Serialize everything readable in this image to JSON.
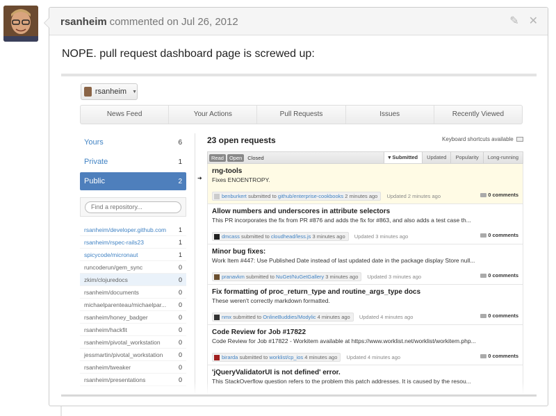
{
  "comment": {
    "author": "rsanheim",
    "action": "commented on Jul 26, 2012",
    "text": "NOPE. pull request dashboard page is screwed up:"
  },
  "screenshot": {
    "context_user": "rsanheim",
    "tabs": [
      "News Feed",
      "Your Actions",
      "Pull Requests",
      "Issues",
      "Recently Viewed"
    ],
    "filters": [
      {
        "label": "Yours",
        "count": "6"
      },
      {
        "label": "Private",
        "count": "1"
      },
      {
        "label": "Public",
        "count": "2"
      }
    ],
    "repo_search_placeholder": "Find a repository...",
    "repos": [
      {
        "name": "rsanheim/developer.github.com",
        "count": "1"
      },
      {
        "name": "rsanheim/rspec-rails23",
        "count": "1"
      },
      {
        "name": "spicycode/micronaut",
        "count": "1"
      },
      {
        "name": "runcoderun/gem_sync",
        "count": "0"
      },
      {
        "name": "zkim/clojuredocs",
        "count": "0"
      },
      {
        "name": "rsanheim/documents",
        "count": "0"
      },
      {
        "name": "michaelparenteau/michaelpar...",
        "count": "0"
      },
      {
        "name": "rsanheim/honey_badger",
        "count": "0"
      },
      {
        "name": "rsanheim/hackfit",
        "count": "0"
      },
      {
        "name": "rsanheim/pivotal_workstation",
        "count": "0"
      },
      {
        "name": "jessmartin/pivotal_workstation",
        "count": "0"
      },
      {
        "name": "rsanheim/tweaker",
        "count": "0"
      },
      {
        "name": "rsanheim/presentations",
        "count": "0"
      }
    ],
    "main_title": "23 open requests",
    "keyboard_note": "Keyboard shortcuts available",
    "state_buttons": [
      "Read",
      "Open",
      "Closed"
    ],
    "sorts": [
      "Submitted",
      "Updated",
      "Popularity",
      "Long-running"
    ],
    "pull_requests": [
      {
        "title": "rng-tools",
        "desc": "Fixes ENOENTROPY.",
        "user": "benburkert",
        "submitted": "submitted to",
        "repo": "github/enterprise-cookbooks",
        "ago": "2 minutes ago",
        "updated": "Updated 2 minutes ago",
        "comments": "0 comments"
      },
      {
        "title": "Allow numbers and underscores in attribute selectors",
        "desc": "This PR incorporates the fix from PR #876 and adds the fix for #863, and also adds a test case th...",
        "user": "dmcass",
        "submitted": "submitted to",
        "repo": "cloudhead/less.js",
        "ago": "3 minutes ago",
        "updated": "Updated 3 minutes ago",
        "comments": "0 comments"
      },
      {
        "title": "Minor bug fixes:",
        "desc": "Work Item #447: Use Published Date instead of last updated date in the package display Store null...",
        "user": "pranavkm",
        "submitted": "submitted to",
        "repo": "NuGet/NuGetGallery",
        "ago": "3 minutes ago",
        "updated": "Updated 3 minutes ago",
        "comments": "0 comments"
      },
      {
        "title": "Fix formatting of proc_return_type and routine_args_type docs",
        "desc": "These weren't correctly markdown formatted.",
        "user": "nmx",
        "submitted": "submitted to",
        "repo": "OnlineBuddies/Modylic",
        "ago": "4 minutes ago",
        "updated": "Updated 4 minutes ago",
        "comments": "0 comments"
      },
      {
        "title": "Code Review for Job #17822",
        "desc": "Code Review for Job #17822 - Workitem available at https://www.worklist.net/worklist/workitem.php...",
        "user": "birarda",
        "submitted": "submitted to",
        "repo": "worklist/cp_ios",
        "ago": "4 minutes ago",
        "updated": "Updated 4 minutes ago",
        "comments": "0 comments"
      },
      {
        "title": "'jQueryValidatorUI is not defined' error.",
        "desc": "This StackOverflow question refers to the problem this patch addresses. It is caused by the resou...",
        "user": "",
        "submitted": "",
        "repo": "",
        "ago": "",
        "updated": "",
        "comments": ""
      }
    ]
  },
  "colors": {
    "accent": "#4183c4",
    "selected": "#4e7fbc",
    "highlight_row": "#fffbe5"
  }
}
